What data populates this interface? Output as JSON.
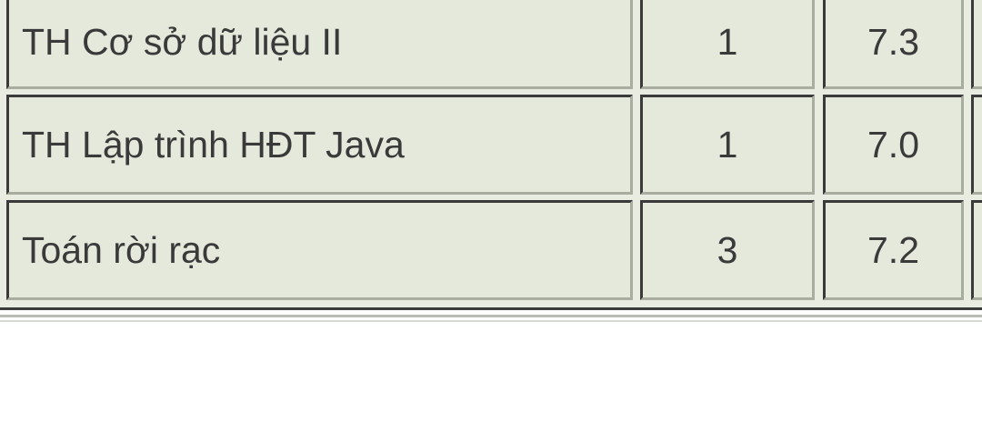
{
  "grades_table": {
    "rows": [
      {
        "course": "TH Cơ sở dữ liệu II",
        "credits": "1",
        "score": "7.3"
      },
      {
        "course": "TH Lập trình HĐT Java",
        "credits": "1",
        "score": "7.0"
      },
      {
        "course": "Toán rời rạc",
        "credits": "3",
        "score": "7.2"
      }
    ]
  },
  "colors": {
    "table_background": "#e4e9dc",
    "border_dark": "#3a3a3a",
    "text": "#3a3a3a",
    "page_background": "#ffffff"
  }
}
